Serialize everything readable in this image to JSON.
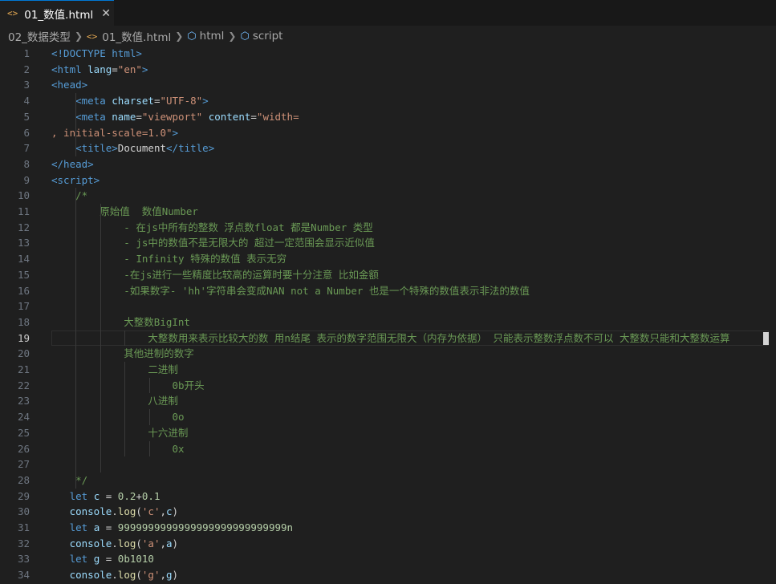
{
  "tab": {
    "icon": "html-file-icon",
    "title": "01_数值.html",
    "close": "✕"
  },
  "breadcrumb": [
    {
      "label": "02_数据类型",
      "icon": ""
    },
    {
      "label": "01_数值.html",
      "icon": "html-file-icon"
    },
    {
      "label": "html",
      "icon": "cube-icon"
    },
    {
      "label": "script",
      "icon": "cube-icon"
    }
  ],
  "editor": {
    "active_line": 19,
    "lines": [
      [
        [
          "t",
          "<!DOCTYPE "
        ],
        [
          "t",
          "html"
        ],
        [
          "t",
          ">"
        ]
      ],
      [
        [
          "t",
          "<html "
        ],
        [
          "a",
          "lang"
        ],
        [
          "p",
          "="
        ],
        [
          "s",
          "\"en\""
        ],
        [
          "t",
          ">"
        ]
      ],
      [
        [
          "t",
          "<head>"
        ]
      ],
      [
        [
          "p",
          "    "
        ],
        [
          "t",
          "<meta "
        ],
        [
          "a",
          "charset"
        ],
        [
          "p",
          "="
        ],
        [
          "s",
          "\"UTF-8\""
        ],
        [
          "t",
          ">"
        ]
      ],
      [
        [
          "p",
          "    "
        ],
        [
          "t",
          "<meta "
        ],
        [
          "a",
          "name"
        ],
        [
          "p",
          "="
        ],
        [
          "s",
          "\"viewport\""
        ],
        [
          "p",
          " "
        ],
        [
          "a",
          "content"
        ],
        [
          "p",
          "="
        ],
        [
          "s",
          "\"width="
        ]
      ],
      [
        [
          "s",
          ", initial-scale=1.0\""
        ],
        [
          "t",
          ">"
        ]
      ],
      [
        [
          "p",
          "    "
        ],
        [
          "t",
          "<title>"
        ],
        [
          "p",
          "Document"
        ],
        [
          "t",
          "</title>"
        ]
      ],
      [
        [
          "t",
          "</head>"
        ]
      ],
      [
        [
          "t",
          "<script>"
        ]
      ],
      [
        [
          "c",
          "    /*"
        ]
      ],
      [
        [
          "c",
          "        原始值  数值Number"
        ]
      ],
      [
        [
          "c",
          "            - 在js中所有的整数 浮点数float 都是Number 类型"
        ]
      ],
      [
        [
          "c",
          "            - js中的数值不是无限大的 超过一定范围会显示近似值"
        ]
      ],
      [
        [
          "c",
          "            - Infinity 特殊的数值 表示无穷"
        ]
      ],
      [
        [
          "c",
          "            -在js进行一些精度比较高的运算时要十分注意 比如金额"
        ]
      ],
      [
        [
          "c",
          "            -如果数字- 'hh'字符串会变成NAN not a Number 也是一个特殊的数值表示非法的数值"
        ]
      ],
      [],
      [
        [
          "c",
          "            大整数BigInt"
        ]
      ],
      [
        [
          "c",
          "                大整数用来表示比较大的数 用n结尾 表示的数字范围无限大（内存为依据） 只能表示整数浮点数不可以 大整数只能和大整数运算"
        ]
      ],
      [
        [
          "c",
          "            其他进制的数字"
        ]
      ],
      [
        [
          "c",
          "                二进制"
        ]
      ],
      [
        [
          "c",
          "                    0b开头"
        ]
      ],
      [
        [
          "c",
          "                八进制"
        ]
      ],
      [
        [
          "c",
          "                    0o"
        ]
      ],
      [
        [
          "c",
          "                十六进制"
        ]
      ],
      [
        [
          "c",
          "                    0x"
        ]
      ],
      [],
      [
        [
          "c",
          "    */"
        ]
      ],
      [
        [
          "p",
          "   "
        ],
        [
          "k",
          "let "
        ],
        [
          "v",
          "c"
        ],
        [
          "p",
          " = "
        ],
        [
          "n",
          "0.2"
        ],
        [
          "p",
          "+"
        ],
        [
          "n",
          "0.1"
        ]
      ],
      [
        [
          "p",
          "   "
        ],
        [
          "v",
          "console"
        ],
        [
          "p",
          "."
        ],
        [
          "f",
          "log"
        ],
        [
          "p",
          "("
        ],
        [
          "s",
          "'c'"
        ],
        [
          "p",
          ","
        ],
        [
          "v",
          "c"
        ],
        [
          "p",
          ")"
        ]
      ],
      [
        [
          "p",
          "   "
        ],
        [
          "k",
          "let "
        ],
        [
          "v",
          "a"
        ],
        [
          "p",
          " = "
        ],
        [
          "n",
          "9999999999999999999999999999n"
        ]
      ],
      [
        [
          "p",
          "   "
        ],
        [
          "v",
          "console"
        ],
        [
          "p",
          "."
        ],
        [
          "f",
          "log"
        ],
        [
          "p",
          "("
        ],
        [
          "s",
          "'a'"
        ],
        [
          "p",
          ","
        ],
        [
          "v",
          "a"
        ],
        [
          "p",
          ")"
        ]
      ],
      [
        [
          "p",
          "   "
        ],
        [
          "k",
          "let "
        ],
        [
          "v",
          "g"
        ],
        [
          "p",
          " = "
        ],
        [
          "n",
          "0b1010"
        ]
      ],
      [
        [
          "p",
          "   "
        ],
        [
          "v",
          "console"
        ],
        [
          "p",
          "."
        ],
        [
          "f",
          "log"
        ],
        [
          "p",
          "("
        ],
        [
          "s",
          "'g'"
        ],
        [
          "p",
          ","
        ],
        [
          "v",
          "g"
        ],
        [
          "p",
          ")"
        ]
      ]
    ]
  }
}
